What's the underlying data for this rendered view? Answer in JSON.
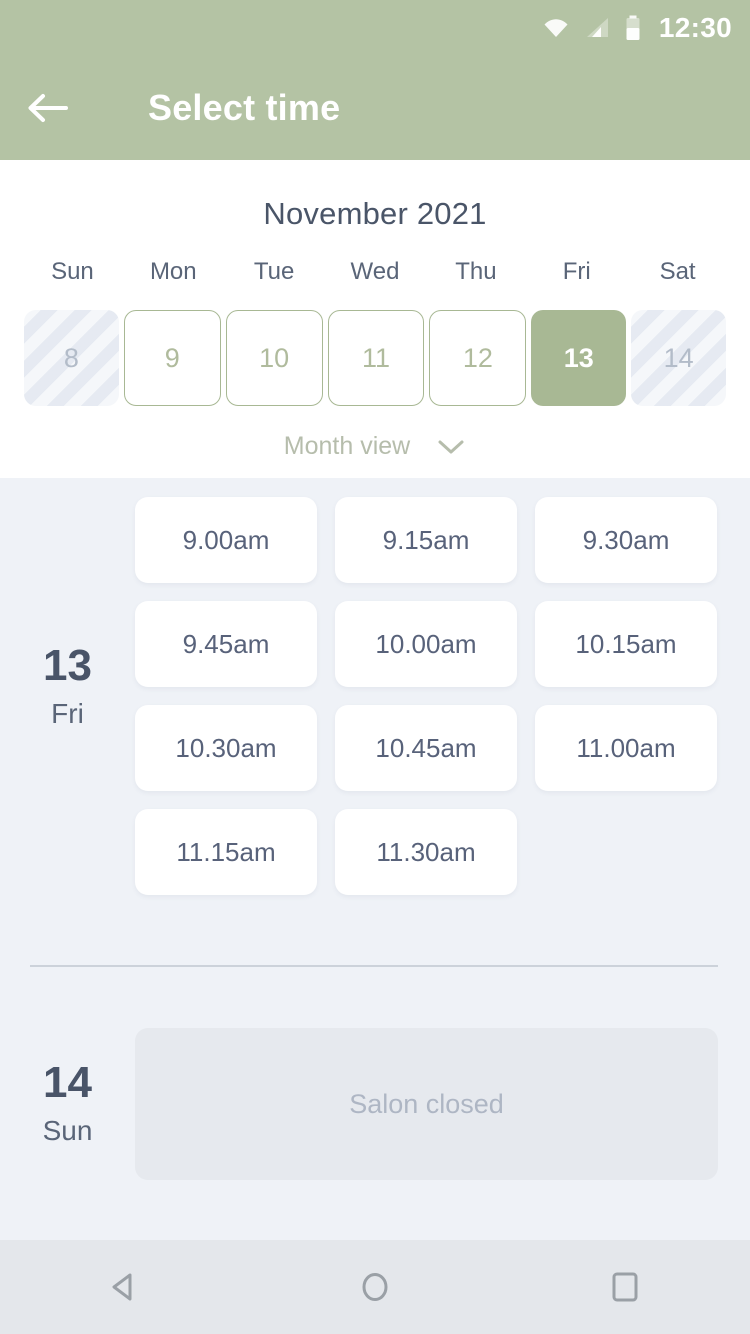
{
  "statusbar": {
    "time": "12:30",
    "icons": [
      "wifi-icon",
      "cellular-signal-icon",
      "battery-icon"
    ]
  },
  "appbar": {
    "back_icon": "arrow-left-icon",
    "title": "Select time"
  },
  "calendar": {
    "month_title": "November 2021",
    "weekdays": [
      "Sun",
      "Mon",
      "Tue",
      "Wed",
      "Thu",
      "Fri",
      "Sat"
    ],
    "dates": [
      {
        "day": "8",
        "state": "disabled"
      },
      {
        "day": "9",
        "state": "available"
      },
      {
        "day": "10",
        "state": "available"
      },
      {
        "day": "11",
        "state": "available"
      },
      {
        "day": "12",
        "state": "available"
      },
      {
        "day": "13",
        "state": "selected"
      },
      {
        "day": "14",
        "state": "disabled"
      }
    ],
    "view_toggle": {
      "label": "Month view",
      "icon": "chevron-down-icon"
    }
  },
  "schedule": {
    "days": [
      {
        "date_number": "13",
        "weekday": "Fri",
        "slots": [
          "9.00am",
          "9.15am",
          "9.30am",
          "9.45am",
          "10.00am",
          "10.15am",
          "10.30am",
          "10.45am",
          "11.00am",
          "11.15am",
          "11.30am"
        ]
      },
      {
        "date_number": "14",
        "weekday": "Sun",
        "closed_message": "Salon closed"
      }
    ]
  },
  "navbar": {
    "back": "nav-back-icon",
    "home": "nav-home-icon",
    "recents": "nav-recents-icon"
  },
  "colors": {
    "accent": "#a8b894",
    "appbar": "#b4c3a4",
    "body_bg": "#eff2f7",
    "text_dark": "#495468",
    "text_muted": "#aeb6c4"
  }
}
